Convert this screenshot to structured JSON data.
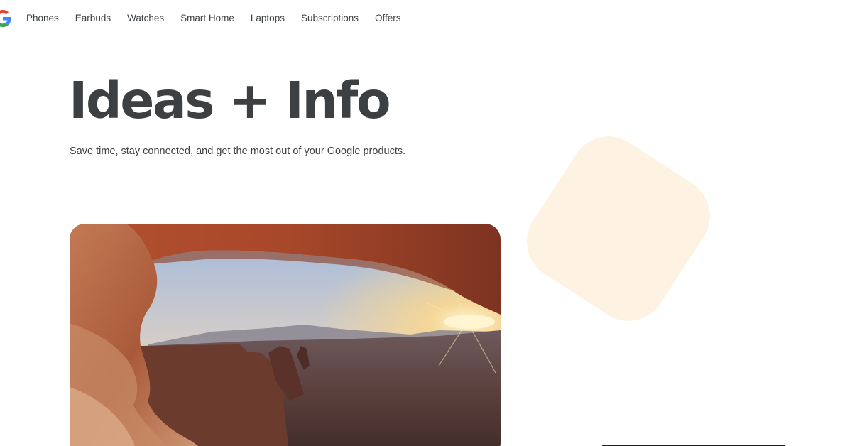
{
  "nav": {
    "logo_icon": "google-g-logo",
    "items": [
      {
        "label": "Phones"
      },
      {
        "label": "Earbuds"
      },
      {
        "label": "Watches"
      },
      {
        "label": "Smart Home"
      },
      {
        "label": "Laptops"
      },
      {
        "label": "Subscriptions"
      },
      {
        "label": "Offers"
      }
    ]
  },
  "hero": {
    "title": "Ideas + Info",
    "subtitle": "Save time, stay connected, and get the most out of your Google products."
  },
  "colors": {
    "text": "#3c4043",
    "blob": "#fef2e3",
    "google_blue": "#4285F4",
    "google_red": "#EA4335",
    "google_yellow": "#FBBC05",
    "google_green": "#34A853"
  }
}
